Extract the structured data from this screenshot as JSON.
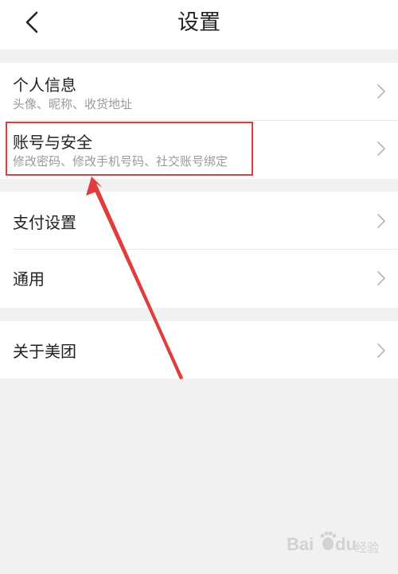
{
  "header": {
    "title": "设置",
    "back_icon": "chevron-left-icon"
  },
  "groups": [
    {
      "items": [
        {
          "label": "个人信息",
          "sub": "头像、昵称、收货地址"
        },
        {
          "label": "账号与安全",
          "sub": "修改密码、修改手机号码、社交账号绑定"
        }
      ]
    },
    {
      "items": [
        {
          "label": "支付设置"
        },
        {
          "label": "通用"
        }
      ]
    },
    {
      "items": [
        {
          "label": "关于美团"
        }
      ]
    }
  ],
  "annotation": {
    "highlight_color": "#e03d3d"
  },
  "watermark": {
    "text": "Bai du 经验"
  }
}
